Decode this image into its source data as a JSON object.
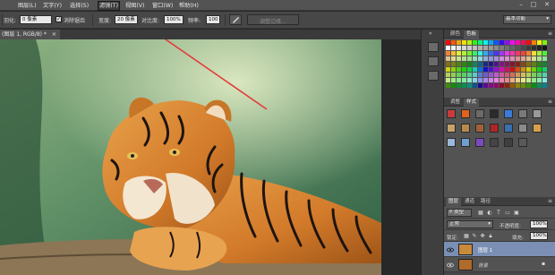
{
  "menubar": {
    "items": [
      "图层(L)",
      "文字(Y)",
      "选择(S)",
      "滤镜(T)",
      "视图(V)",
      "窗口(W)",
      "帮助(H)"
    ],
    "active_index": 3,
    "window_controls": [
      "–",
      "□",
      "✕"
    ]
  },
  "options": {
    "feather_label": "羽化:",
    "feather_value": "0 像素",
    "antialias_label": "消除锯齿",
    "width_label": "宽度:",
    "width_value": "20 像素",
    "contrast_label": "对比度:",
    "contrast_value": "100%",
    "frequency_label": "频率:",
    "frequency_value": "100",
    "refine_edge_label": "调整边缘...",
    "workspace_value": "基本功能"
  },
  "document": {
    "tab_label": "(图层 1, RGB/8) *",
    "close_glyph": "×"
  },
  "panels": {
    "swatches_tabs": [
      "颜色",
      "色板"
    ],
    "styles_tabs": [
      "调整",
      "样式"
    ],
    "layers_tabs": [
      "图层",
      "通道",
      "路径"
    ],
    "filter_label": "P 类型",
    "blend_mode": "正常",
    "opacity_label": "不透明度:",
    "opacity_value": "100%",
    "lock_label": "锁定:",
    "fill_label": "填充:",
    "fill_value": "100%",
    "layers": [
      {
        "name": "图层 1",
        "selected": true
      },
      {
        "name": "背景",
        "selected": false
      }
    ],
    "menu_glyph": "≡",
    "collapse_glyph": "»"
  },
  "colors": {
    "ui_dark": "#282828",
    "menubar": "#535353",
    "panel": "#535353",
    "selected_layer": "#7a8fb3",
    "annotation_arrow": "#e23b3b"
  },
  "icons": {
    "marquee": "rectangle-marquee-icon",
    "eye": "eye-icon",
    "lock": "lock-icon",
    "link": "link-icon",
    "mask": "mask-icon",
    "new_layer": "new-layer-icon",
    "trash": "trash-icon"
  }
}
